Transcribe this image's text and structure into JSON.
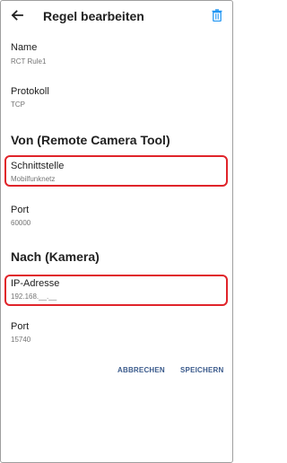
{
  "header": {
    "title": "Regel bearbeiten",
    "back_icon": "arrow-left-icon",
    "delete_icon": "trash-icon",
    "accent_color": "#2196f3"
  },
  "fields": {
    "name": {
      "label": "Name",
      "value": "RCT Rule1"
    },
    "protocol": {
      "label": "Protokoll",
      "value": "TCP"
    }
  },
  "from_section": {
    "title": "Von (Remote Camera Tool)",
    "interface": {
      "label": "Schnittstelle",
      "value": "Mobilfunknetz"
    },
    "port": {
      "label": "Port",
      "value": "60000"
    }
  },
  "to_section": {
    "title": "Nach (Kamera)",
    "ip_address": {
      "label": "IP-Adresse",
      "value": "192.168.__.__"
    },
    "port": {
      "label": "Port",
      "value": "15740"
    }
  },
  "actions": {
    "cancel_label": "ABBRECHEN",
    "save_label": "SPEICHERN"
  },
  "highlight_color": "#e0242a"
}
